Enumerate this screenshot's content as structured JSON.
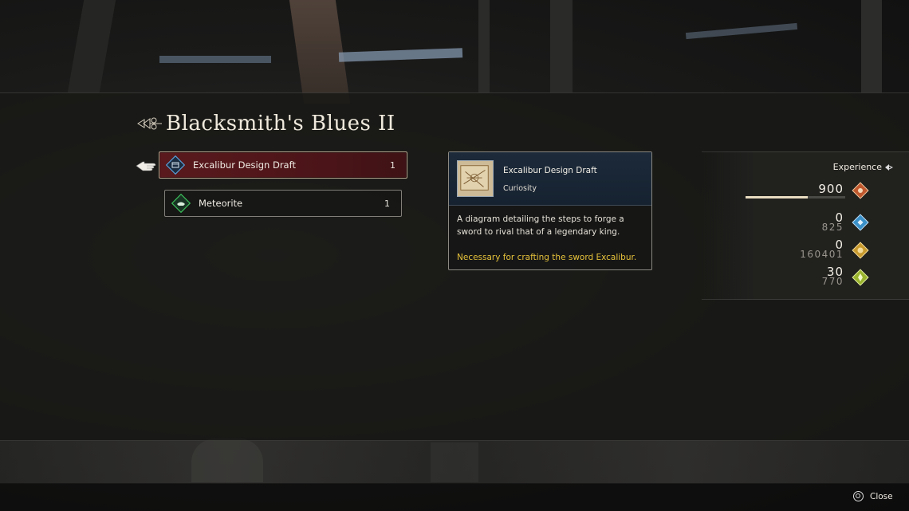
{
  "quest": {
    "title": "Blacksmith's Blues II"
  },
  "items": [
    {
      "name": "Excalibur Design Draft",
      "qty": "1",
      "selected": true,
      "icon": "blueprint-icon"
    },
    {
      "name": "Meteorite",
      "qty": "1",
      "selected": false,
      "icon": "ore-icon"
    }
  ],
  "detail": {
    "name": "Excalibur Design Draft",
    "category": "Curiosity",
    "description": "A diagram detailing the steps to forge a sword to rival that of a legendary king.",
    "note": "Necessary for crafting the sword Excalibur."
  },
  "experience": {
    "label": "Experience",
    "progress": 0.62,
    "rows": [
      {
        "value": "900",
        "sub": "",
        "icon": "exp-gem-icon",
        "color": "#c0582e"
      },
      {
        "value": "0",
        "sub": "825",
        "icon": "ap-gem-icon",
        "color": "#3a90c8"
      },
      {
        "value": "0",
        "sub": "160401",
        "icon": "gil-coin-icon",
        "color": "#c89a2e"
      },
      {
        "value": "30",
        "sub": "770",
        "icon": "skill-gem-icon",
        "color": "#9ab42e"
      }
    ]
  },
  "footer": {
    "close_label": "Close"
  },
  "colors": {
    "selected_bg": "#5a1a1d",
    "note_text": "#e6c23a",
    "panel_head": "#1c2a3a"
  }
}
